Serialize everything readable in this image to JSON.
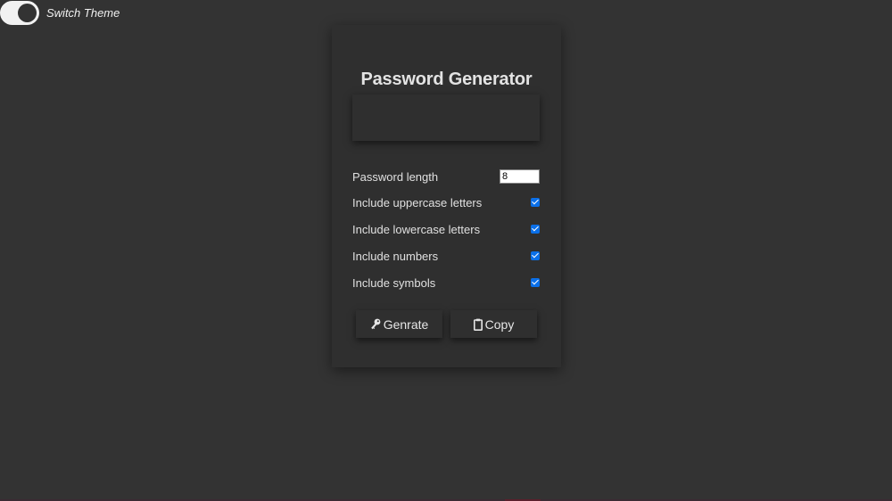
{
  "theme_switch": {
    "label": "Switch Theme",
    "on": true
  },
  "card": {
    "title": "Password Generator",
    "result_value": ""
  },
  "options": {
    "length_label": "Password length",
    "length_value": "8",
    "uppercase_label": "Include uppercase letters",
    "uppercase_checked": true,
    "lowercase_label": "Include lowercase letters",
    "lowercase_checked": true,
    "numbers_label": "Include numbers",
    "numbers_checked": true,
    "symbols_label": "Include symbols",
    "symbols_checked": true
  },
  "buttons": {
    "generate_label": "Genrate",
    "generate_icon": "key-icon",
    "copy_label": "Copy",
    "copy_icon": "clipboard-icon"
  },
  "colors": {
    "background": "#333333",
    "card": "#2f2f2f",
    "checkbox": "#0a6fe8"
  }
}
